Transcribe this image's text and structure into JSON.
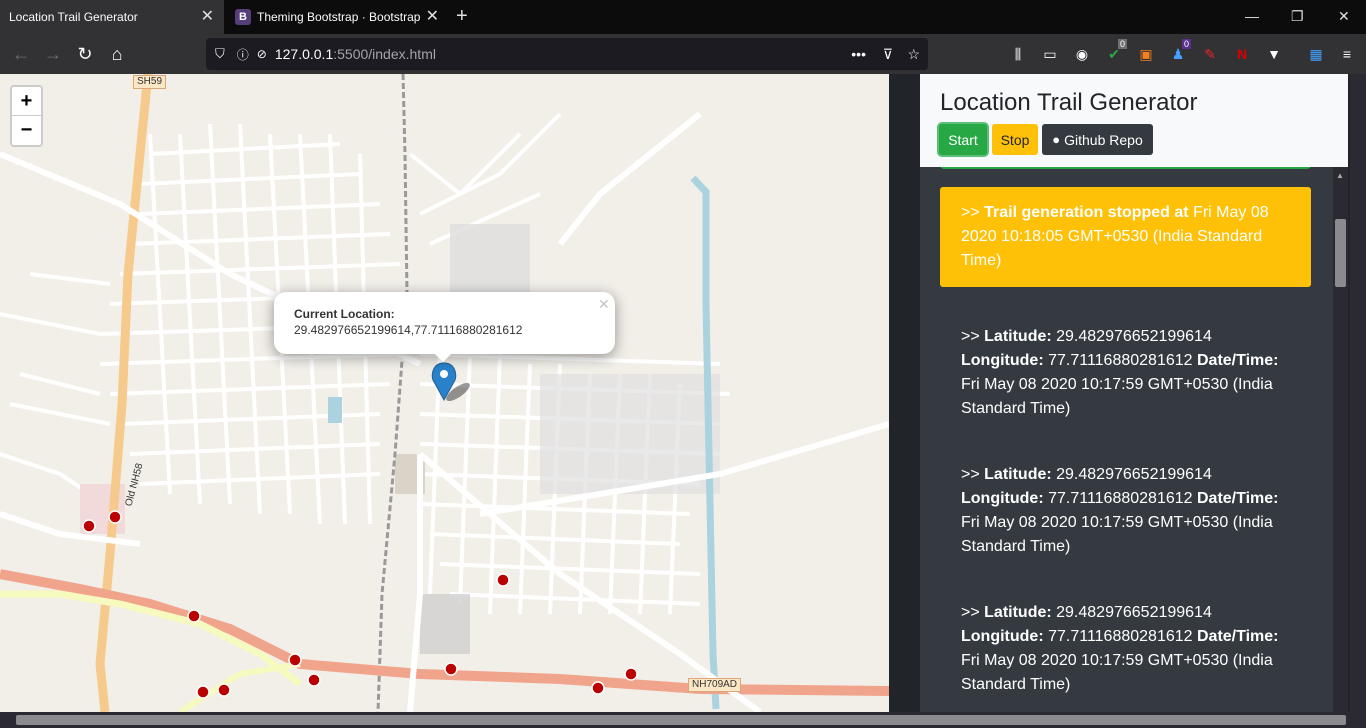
{
  "browser": {
    "tabs": [
      {
        "title": "Location Trail Generator",
        "active": true
      },
      {
        "title": "Theming Bootstrap · Bootstrap",
        "active": false,
        "favicon": "B"
      }
    ],
    "url": {
      "host": "127.0.0.1",
      "rest": ":5500/index.html"
    },
    "badges": {
      "shield_count": "0",
      "notif_count": "0"
    }
  },
  "map": {
    "popup": {
      "title": "Current Location:",
      "coords": "29.482976652199614,77.71116880281612"
    },
    "labels": {
      "sh59": "SH59",
      "nh58": "Old NH58",
      "nh709": "NH709AD"
    },
    "zoom_in": "+",
    "zoom_out": "−"
  },
  "panel": {
    "title": "Location Trail Generator",
    "buttons": {
      "start": "Start",
      "stop": "Stop",
      "github": "Github Repo"
    },
    "logs": [
      {
        "prefix": ">> ",
        "label": "Trail generation stopped at",
        "text": " Fri May 08 2020 10:18:05 GMT+0530 (India Standard Time)",
        "color": "#ffc107"
      },
      {
        "prefix": ">> ",
        "lat_label": "Latitude:",
        "lat": " 29.482976652199614 ",
        "lng_label": "Longitude:",
        "lng": " 77.71116880281612 ",
        "dt_label": "Date/Time:",
        "dt": " Fri May 08 2020 10:17:59 GMT+0530 (India Standard Time)"
      },
      {
        "prefix": ">> ",
        "lat_label": "Latitude:",
        "lat": " 29.482976652199614 ",
        "lng_label": "Longitude:",
        "lng": " 77.71116880281612 ",
        "dt_label": "Date/Time:",
        "dt": " Fri May 08 2020 10:17:59 GMT+0530 (India Standard Time)"
      },
      {
        "prefix": ">> ",
        "lat_label": "Latitude:",
        "lat": " 29.482976652199614 ",
        "lng_label": "Longitude:",
        "lng": " 77.71116880281612 ",
        "dt_label": "Date/Time:",
        "dt": " Fri May 08 2020 10:17:59 GMT+0530 (India Standard Time)"
      }
    ]
  }
}
